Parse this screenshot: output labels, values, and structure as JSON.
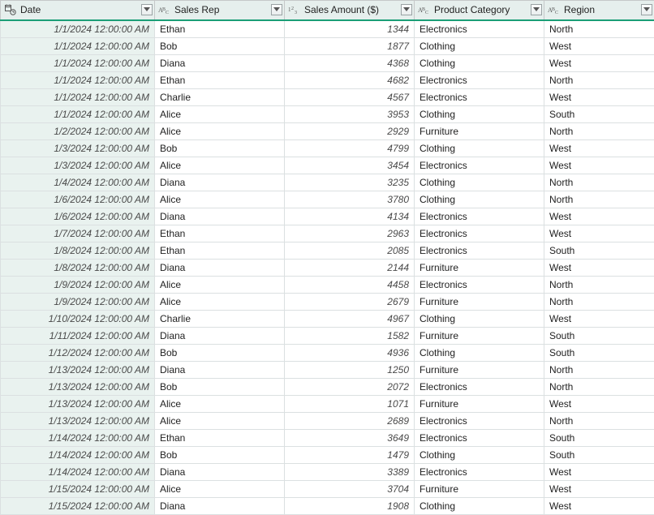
{
  "columns": [
    {
      "key": "date",
      "label": "Date",
      "type": "datetime",
      "align": "right",
      "italic": true
    },
    {
      "key": "rep",
      "label": "Sales Rep",
      "type": "text",
      "align": "left",
      "italic": false
    },
    {
      "key": "amount",
      "label": "Sales Amount ($)",
      "type": "number",
      "align": "right",
      "italic": true
    },
    {
      "key": "cat",
      "label": "Product Category",
      "type": "text",
      "align": "left",
      "italic": false
    },
    {
      "key": "region",
      "label": "Region",
      "type": "text",
      "align": "left",
      "italic": false
    }
  ],
  "rows": [
    {
      "date": "1/1/2024 12:00:00 AM",
      "rep": "Ethan",
      "amount": 1344,
      "cat": "Electronics",
      "region": "North"
    },
    {
      "date": "1/1/2024 12:00:00 AM",
      "rep": "Bob",
      "amount": 1877,
      "cat": "Clothing",
      "region": "West"
    },
    {
      "date": "1/1/2024 12:00:00 AM",
      "rep": "Diana",
      "amount": 4368,
      "cat": "Clothing",
      "region": "West"
    },
    {
      "date": "1/1/2024 12:00:00 AM",
      "rep": "Ethan",
      "amount": 4682,
      "cat": "Electronics",
      "region": "North"
    },
    {
      "date": "1/1/2024 12:00:00 AM",
      "rep": "Charlie",
      "amount": 4567,
      "cat": "Electronics",
      "region": "West"
    },
    {
      "date": "1/1/2024 12:00:00 AM",
      "rep": "Alice",
      "amount": 3953,
      "cat": "Clothing",
      "region": "South"
    },
    {
      "date": "1/2/2024 12:00:00 AM",
      "rep": "Alice",
      "amount": 2929,
      "cat": "Furniture",
      "region": "North"
    },
    {
      "date": "1/3/2024 12:00:00 AM",
      "rep": "Bob",
      "amount": 4799,
      "cat": "Clothing",
      "region": "West"
    },
    {
      "date": "1/3/2024 12:00:00 AM",
      "rep": "Alice",
      "amount": 3454,
      "cat": "Electronics",
      "region": "West"
    },
    {
      "date": "1/4/2024 12:00:00 AM",
      "rep": "Diana",
      "amount": 3235,
      "cat": "Clothing",
      "region": "North"
    },
    {
      "date": "1/6/2024 12:00:00 AM",
      "rep": "Alice",
      "amount": 3780,
      "cat": "Clothing",
      "region": "North"
    },
    {
      "date": "1/6/2024 12:00:00 AM",
      "rep": "Diana",
      "amount": 4134,
      "cat": "Electronics",
      "region": "West"
    },
    {
      "date": "1/7/2024 12:00:00 AM",
      "rep": "Ethan",
      "amount": 2963,
      "cat": "Electronics",
      "region": "West"
    },
    {
      "date": "1/8/2024 12:00:00 AM",
      "rep": "Ethan",
      "amount": 2085,
      "cat": "Electronics",
      "region": "South"
    },
    {
      "date": "1/8/2024 12:00:00 AM",
      "rep": "Diana",
      "amount": 2144,
      "cat": "Furniture",
      "region": "West"
    },
    {
      "date": "1/9/2024 12:00:00 AM",
      "rep": "Alice",
      "amount": 4458,
      "cat": "Electronics",
      "region": "North"
    },
    {
      "date": "1/9/2024 12:00:00 AM",
      "rep": "Alice",
      "amount": 2679,
      "cat": "Furniture",
      "region": "North"
    },
    {
      "date": "1/10/2024 12:00:00 AM",
      "rep": "Charlie",
      "amount": 4967,
      "cat": "Clothing",
      "region": "West"
    },
    {
      "date": "1/11/2024 12:00:00 AM",
      "rep": "Diana",
      "amount": 1582,
      "cat": "Furniture",
      "region": "South"
    },
    {
      "date": "1/12/2024 12:00:00 AM",
      "rep": "Bob",
      "amount": 4936,
      "cat": "Clothing",
      "region": "South"
    },
    {
      "date": "1/13/2024 12:00:00 AM",
      "rep": "Diana",
      "amount": 1250,
      "cat": "Furniture",
      "region": "North"
    },
    {
      "date": "1/13/2024 12:00:00 AM",
      "rep": "Bob",
      "amount": 2072,
      "cat": "Electronics",
      "region": "North"
    },
    {
      "date": "1/13/2024 12:00:00 AM",
      "rep": "Alice",
      "amount": 1071,
      "cat": "Furniture",
      "region": "West"
    },
    {
      "date": "1/13/2024 12:00:00 AM",
      "rep": "Alice",
      "amount": 2689,
      "cat": "Electronics",
      "region": "North"
    },
    {
      "date": "1/14/2024 12:00:00 AM",
      "rep": "Ethan",
      "amount": 3649,
      "cat": "Electronics",
      "region": "South"
    },
    {
      "date": "1/14/2024 12:00:00 AM",
      "rep": "Bob",
      "amount": 1479,
      "cat": "Clothing",
      "region": "South"
    },
    {
      "date": "1/14/2024 12:00:00 AM",
      "rep": "Diana",
      "amount": 3389,
      "cat": "Electronics",
      "region": "West"
    },
    {
      "date": "1/15/2024 12:00:00 AM",
      "rep": "Alice",
      "amount": 3704,
      "cat": "Furniture",
      "region": "West"
    },
    {
      "date": "1/15/2024 12:00:00 AM",
      "rep": "Diana",
      "amount": 1908,
      "cat": "Clothing",
      "region": "West"
    }
  ]
}
